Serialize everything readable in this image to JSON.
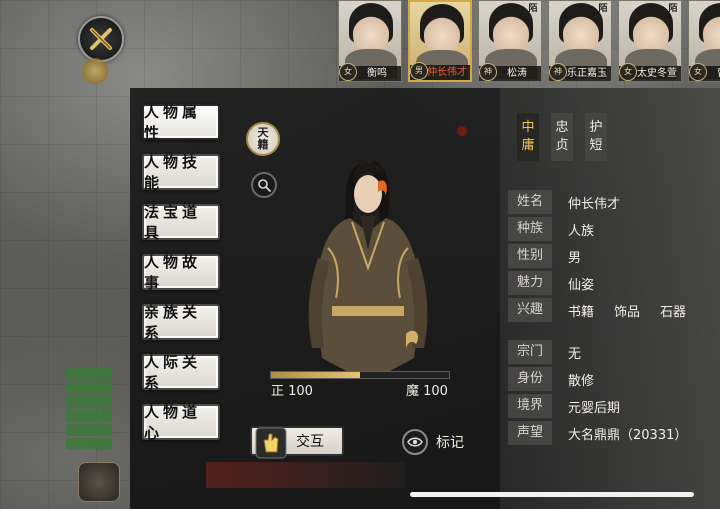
{
  "portraits": [
    {
      "name": "衡鸣",
      "badge": "女",
      "tag": "",
      "selected": false
    },
    {
      "name": "仲长伟才",
      "badge": "男",
      "tag": "",
      "selected": true
    },
    {
      "name": "松涛",
      "badge": "神",
      "tag": "陌",
      "selected": false
    },
    {
      "name": "乐正嘉玉",
      "badge": "神",
      "tag": "陌",
      "selected": false
    },
    {
      "name": "太史冬萱",
      "badge": "女",
      "tag": "陌",
      "selected": false
    },
    {
      "name": "曹蕊",
      "badge": "女",
      "tag": "",
      "selected": false
    }
  ],
  "nav": [
    {
      "label": "人物属性",
      "active": true
    },
    {
      "label": "人物技能",
      "active": false
    },
    {
      "label": "法宝道具",
      "active": false
    },
    {
      "label": "人物故事",
      "active": false
    },
    {
      "label": "亲族关系",
      "active": false
    },
    {
      "label": "人际关系",
      "active": false
    },
    {
      "label": "人物道心",
      "active": false
    }
  ],
  "tianji": {
    "line1": "天",
    "line2": "籍"
  },
  "alignment": {
    "left_label": "正 100",
    "right_label": "魔 100",
    "fill_fraction": 0.5
  },
  "actions": {
    "interact": "交互",
    "mark": "标记"
  },
  "traits": [
    {
      "chars": [
        "中",
        "庸"
      ],
      "gold": true
    },
    {
      "chars": [
        "忠",
        "贞"
      ],
      "gold": false
    },
    {
      "chars": [
        "护",
        "短"
      ],
      "gold": false
    }
  ],
  "info": {
    "name": {
      "label": "姓名",
      "value": "仲长伟才"
    },
    "race": {
      "label": "种族",
      "value": "人族"
    },
    "gender": {
      "label": "性别",
      "value": "男"
    },
    "charm": {
      "label": "魅力",
      "value": "仙姿"
    },
    "hobby": {
      "label": "兴趣",
      "values": [
        "书籍",
        "饰品",
        "石器"
      ]
    },
    "sect": {
      "label": "宗门",
      "value": "无"
    },
    "identity": {
      "label": "身份",
      "value": "散修"
    },
    "realm": {
      "label": "境界",
      "value": "元婴后期"
    },
    "fame": {
      "label": "声望",
      "value": "大名鼎鼎（20331）"
    }
  },
  "colors": {
    "accent_gold": "#d4a84a",
    "selected_name": "#f05a3a",
    "trait_gold": "#f0c455"
  }
}
